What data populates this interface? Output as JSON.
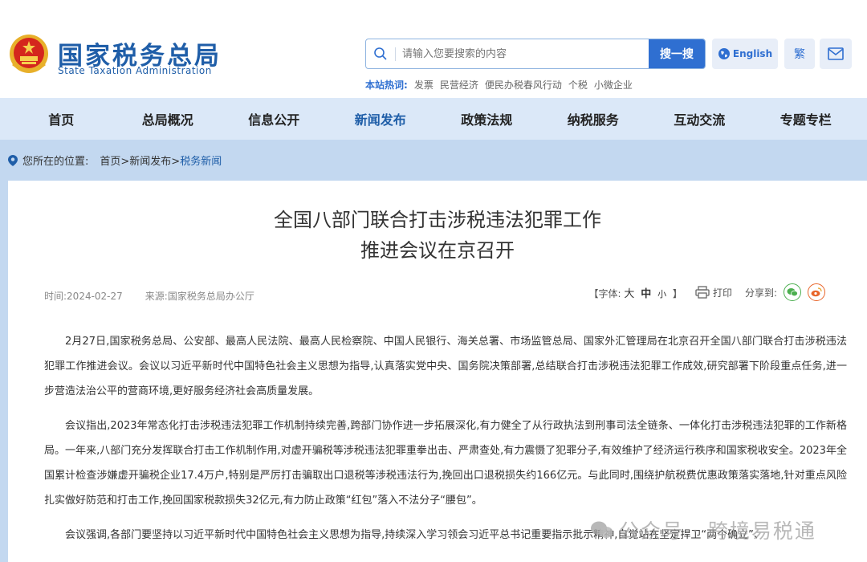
{
  "header": {
    "site_title": "国家税务总局",
    "site_subtitle": "State Taxation Administration",
    "search_placeholder": "请输入您要搜索的内容",
    "search_button": "搜一搜",
    "english_button": "English",
    "traditional_button": "繁",
    "hot_label": "本站热词:",
    "hot_words": [
      "发票",
      "民营经济",
      "便民办税春风行动",
      "个税",
      "小微企业"
    ]
  },
  "nav": {
    "items": [
      "首页",
      "总局概况",
      "信息公开",
      "新闻发布",
      "政策法规",
      "纳税服务",
      "互动交流",
      "专题专栏"
    ],
    "active_index": 3
  },
  "breadcrumb": {
    "label": "您所在的位置:",
    "path": "首页>新闻发布>",
    "current": "税务新闻"
  },
  "article": {
    "title_line1": "全国八部门联合打击涉税违法犯罪工作",
    "title_line2": "推进会议在京召开",
    "time": "时间:2024-02-27",
    "source": "来源:国家税务总局办公厅",
    "font_label_open": "【字体:",
    "font_large": "大",
    "font_medium": "中",
    "font_small": "小",
    "font_label_close": "】",
    "print": "打印",
    "share": "分享到:",
    "paragraphs": [
      "2月27日,国家税务总局、公安部、最高人民法院、最高人民检察院、中国人民银行、海关总署、市场监管总局、国家外汇管理局在北京召开全国八部门联合打击涉税违法犯罪工作推进会议。会议以习近平新时代中国特色社会主义思想为指导,认真落实党中央、国务院决策部署,总结联合打击涉税违法犯罪工作成效,研究部署下阶段重点任务,进一步营造法治公平的营商环境,更好服务经济社会高质量发展。",
      "会议指出,2023年常态化打击涉税违法犯罪工作机制持续完善,跨部门协作进一步拓展深化,有力健全了从行政执法到刑事司法全链条、一体化打击涉税违法犯罪的工作新格局。一年来,八部门充分发挥联合打击工作机制作用,对虚开骗税等涉税违法犯罪重拳出击、严肃查处,有力震慑了犯罪分子,有效维护了经济运行秩序和国家税收安全。2023年全国累计检查涉嫌虚开骗税企业17.4万户,特别是严厉打击骗取出口退税等涉税违法行为,挽回出口退税损失约166亿元。与此同时,围绕护航税费优惠政策落实落地,针对重点风险扎实做好防范和打击工作,挽回国家税款损失32亿元,有力防止政策“红包”落入不法分子“腰包”。",
      "会议强调,各部门要坚持以习近平新时代中国特色社会主义思想为指导,持续深入学习领会习近平总书记重要指示批示精神,自觉站在坚定捍卫“两个确立”、"
    ]
  },
  "watermark": "公众号 · 跨境易税通",
  "colors": {
    "brand_blue": "#1f5ea8",
    "button_blue": "#2f6fd1",
    "nav_bg": "#dbe8f8",
    "page_bg": "#c3d8f0"
  }
}
